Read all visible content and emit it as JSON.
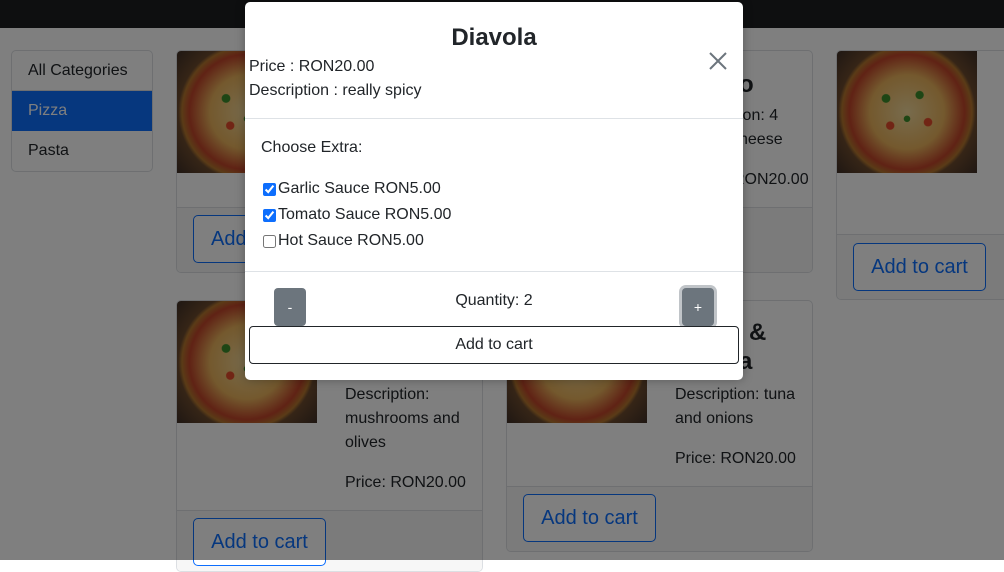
{
  "sidebar": {
    "items": [
      {
        "label": "All Categories",
        "active": false
      },
      {
        "label": "Pizza",
        "active": true
      },
      {
        "label": "Pasta",
        "active": false
      }
    ]
  },
  "cards": {
    "c1": {
      "add_label": "Add"
    },
    "c2": {
      "title_fragment": "o",
      "desc_fragment_1": "ion: 4",
      "desc_fragment_2": "heese",
      "price_fragment": "RON20.00"
    },
    "c3": {
      "add_label": "Add to cart"
    },
    "c4": {
      "desc_1": "Description:",
      "desc_2": "mushrooms and",
      "desc_3": "olives",
      "price": "Price: RON20.00",
      "add_label": "Add to cart"
    },
    "c5": {
      "title_1": "&",
      "title_2": "a",
      "desc_1": "Description: tuna",
      "desc_2": "and onions",
      "price": "Price: RON20.00",
      "add_label": "Add to cart"
    }
  },
  "modal": {
    "title": "Diavola",
    "price": "Price : RON20.00",
    "description": "Description : really spicy",
    "extras_heading": "Choose Extra:",
    "extras": [
      {
        "label": "Garlic Sauce RON5.00",
        "checked": true
      },
      {
        "label": "Tomato Sauce RON5.00",
        "checked": true
      },
      {
        "label": "Hot Sauce RON5.00",
        "checked": false
      }
    ],
    "minus_label": "-",
    "plus_label": "+",
    "quantity_text": "Quantity: 2",
    "add_to_cart_label": "Add to cart"
  },
  "colors": {
    "primary": "#0d6efd",
    "topbar": "#1c1e21",
    "secondary": "#6c757d"
  }
}
